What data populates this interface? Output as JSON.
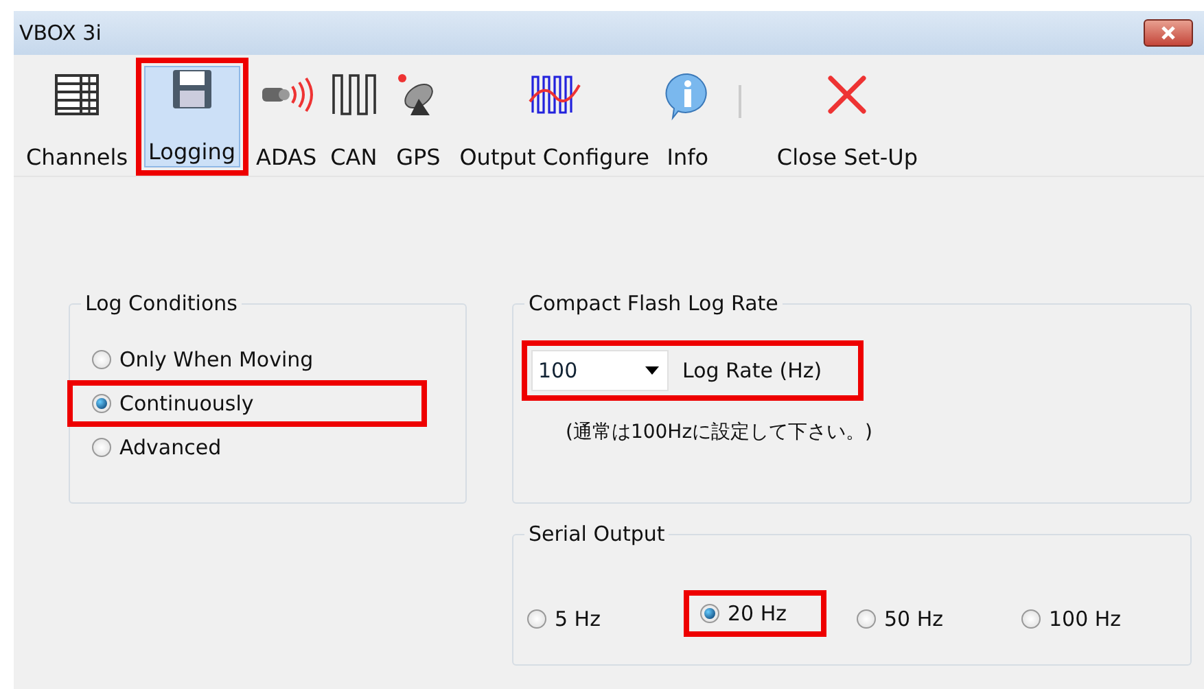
{
  "window": {
    "title": "VBOX 3i"
  },
  "toolbar": [
    {
      "label": "Channels",
      "selected": false,
      "highlighted": false
    },
    {
      "label": "Logging",
      "selected": true,
      "highlighted": true
    },
    {
      "label": "ADAS",
      "selected": false,
      "highlighted": false
    },
    {
      "label": "CAN",
      "selected": false,
      "highlighted": false
    },
    {
      "label": "GPS",
      "selected": false,
      "highlighted": false
    },
    {
      "label": "Output Configure",
      "selected": false,
      "highlighted": false
    },
    {
      "label": "Info",
      "selected": false,
      "highlighted": false
    },
    {
      "label": "Close Set-Up",
      "selected": false,
      "highlighted": false
    }
  ],
  "log_conditions": {
    "title": "Log Conditions",
    "options": [
      {
        "label": "Only When Moving",
        "selected": false,
        "highlighted": false
      },
      {
        "label": "Continuously",
        "selected": true,
        "highlighted": true
      },
      {
        "label": "Advanced",
        "selected": false,
        "highlighted": false
      }
    ]
  },
  "log_rate": {
    "title": "Compact Flash Log Rate",
    "value": "100",
    "label": "Log Rate (Hz)",
    "highlighted": true,
    "note": "(通常は100Hzに設定して下さい。)"
  },
  "serial_output": {
    "title": "Serial Output",
    "options": [
      {
        "label": "5 Hz",
        "selected": false,
        "highlighted": false
      },
      {
        "label": "20 Hz",
        "selected": true,
        "highlighted": true
      },
      {
        "label": "50 Hz",
        "selected": false,
        "highlighted": false
      },
      {
        "label": "100 Hz",
        "selected": false,
        "highlighted": false
      }
    ]
  }
}
